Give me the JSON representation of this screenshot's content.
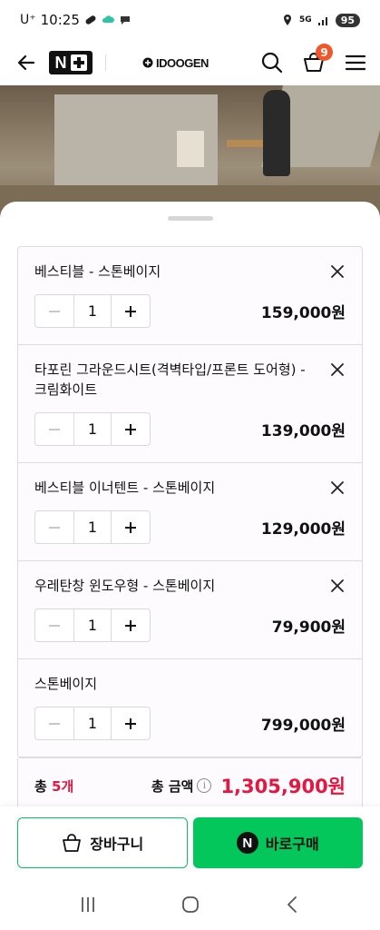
{
  "status_bar": {
    "carrier": "U⁺",
    "time": "10:25",
    "network": "5G",
    "battery": "95"
  },
  "header": {
    "brand": "IDOOGEN",
    "cart_count": "9"
  },
  "cart": {
    "items": [
      {
        "name": "베스티블 - 스톤베이지",
        "quantity": "1",
        "price": "159,000원",
        "removable": true
      },
      {
        "name": "타포린 그라운드시트(격벽타입/프론트 도어형) - 크림화이트",
        "quantity": "1",
        "price": "139,000원",
        "removable": true
      },
      {
        "name": "베스티블 이너텐트 - 스톤베이지",
        "quantity": "1",
        "price": "129,000원",
        "removable": true
      },
      {
        "name": "우레탄창 윈도우형 - 스톤베이지",
        "quantity": "1",
        "price": "79,900원",
        "removable": true
      },
      {
        "name": "스톤베이지",
        "quantity": "1",
        "price": "799,000원",
        "removable": false
      }
    ],
    "total_prefix": "총 ",
    "total_count": "5개",
    "total_label": "총 금액",
    "total_amount": "1,305,900원"
  },
  "actions": {
    "cart_label": "장바구니",
    "buy_label": "바로구매",
    "npay_letter": "N"
  },
  "colors": {
    "accent_red": "#e3173f",
    "naver_green": "#03c75a",
    "badge_orange": "#f0582c"
  }
}
